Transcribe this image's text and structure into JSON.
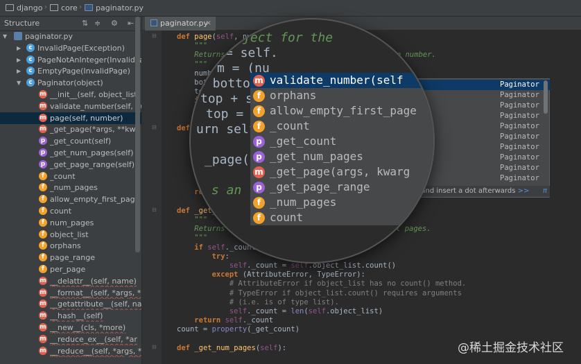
{
  "breadcrumbs": [
    {
      "label": "django",
      "icon": "folder-icon"
    },
    {
      "label": "core",
      "icon": "folder-icon"
    },
    {
      "label": "paginator.py",
      "icon": "python-file-icon"
    }
  ],
  "structure": {
    "title": "Structure",
    "items": [
      {
        "badge": "",
        "label": "paginator.py",
        "expanded": true
      },
      {
        "badge": "c",
        "label": "InvalidPage(Exception)"
      },
      {
        "badge": "c",
        "label": "PageNotAnInteger(InvalidPa"
      },
      {
        "badge": "c",
        "label": "EmptyPage(InvalidPage)"
      },
      {
        "badge": "c",
        "label": "Paginator(object)",
        "expanded": true
      },
      {
        "badge": "m",
        "label": "__init__(self, object_list,"
      },
      {
        "badge": "m",
        "label": "validate_number(self, nu"
      },
      {
        "badge": "m",
        "label": "page(self, number)",
        "selected": true
      },
      {
        "badge": "m",
        "label": "_get_page(*args, **kwa"
      },
      {
        "badge": "p",
        "label": "_get_count(self)"
      },
      {
        "badge": "p",
        "label": "_get_num_pages(self)"
      },
      {
        "badge": "p",
        "label": "_get_page_range(self)"
      },
      {
        "badge": "f",
        "label": "_count"
      },
      {
        "badge": "f",
        "label": "_num_pages"
      },
      {
        "badge": "f",
        "label": "allow_empty_first_page"
      },
      {
        "badge": "f",
        "label": "count"
      },
      {
        "badge": "f",
        "label": "num_pages"
      },
      {
        "badge": "f",
        "label": "object_list"
      },
      {
        "badge": "f",
        "label": "orphans"
      },
      {
        "badge": "f",
        "label": "page_range"
      },
      {
        "badge": "f",
        "label": "per_page"
      },
      {
        "badge": "m",
        "label": "__delattr__(self, name)",
        "dunder": true
      },
      {
        "badge": "m",
        "label": "__format__(self, *args, *",
        "dunder": true
      },
      {
        "badge": "m",
        "label": "__getattribute__(self, na",
        "dunder": true
      },
      {
        "badge": "m",
        "label": "__hash__(self)",
        "dunder": true
      },
      {
        "badge": "m",
        "label": "__new__(cls, *more)",
        "dunder": true
      },
      {
        "badge": "m",
        "label": "__reduce_ex__(self, *ar",
        "dunder": true
      },
      {
        "badge": "m",
        "label": "__reduce__(self, *args, *",
        "dunder": true
      }
    ]
  },
  "editor_tab": {
    "label": "paginator.py",
    "close": "×"
  },
  "code_lines": [
    "def page(self, num",
    "    \"\"\"",
    "    Returns",
    "    \"\"\"",
    "    number",
    "    bott",
    "    top",
    "    if",
    "    r",
    "    ",
    "def _g",
    "    \"\"\"",
    "    Re",
    "    ",
    "    This",
    "    stand",
    "    ",
    "    return F",
    "        ",
    "def _get_count(self",
    "    \"\"\"",
    "    Returns the total number of objects, across all pages.",
    "    \"\"\"",
    "    if self._count is None:",
    "        try:",
    "            self._count = self.object_list.count()",
    "        except (AttributeError, TypeError):",
    "            # AttributeError if object_list has no count() method.",
    "            # TypeError if object_list.count() requires arguments",
    "            # (i.e. is of type list).",
    "            self._count = len(self.object_list)",
    "    return self._count",
    "count = property(_get_count)",
    "",
    "def _get_num_pages(self):"
  ],
  "code_fragments": {
    "doc_partial": "page number.",
    "count_partial": "Ca"
  },
  "lens": {
    "lines": [
      "age object for the",
      "= self.",
      "m = (nu",
      "= bottom",
      "top + se",
      "top = se",
      "urn self.",
      "",
      "_page(*a",
      "",
      "s an ",
      ""
    ],
    "completions": [
      {
        "badge": "m",
        "label": "validate_number(self",
        "selected": true
      },
      {
        "badge": "f",
        "label": "orphans"
      },
      {
        "badge": "f",
        "label": "allow_empty_first_page"
      },
      {
        "badge": "f",
        "label": "_count"
      },
      {
        "badge": "p",
        "label": "_get_count"
      },
      {
        "badge": "p",
        "label": "_get_num_pages"
      },
      {
        "badge": "m",
        "label": "_get_page(args, kwarg"
      },
      {
        "badge": "p",
        "label": "_get_page_range"
      },
      {
        "badge": "f",
        "label": "_num_pages"
      },
      {
        "badge": "f",
        "label": "count"
      }
    ]
  },
  "popup": {
    "rows": [
      "Paginator",
      "Paginator",
      "Paginator",
      "Paginator",
      "Paginator",
      "Paginator",
      "Paginator",
      "Paginator",
      "Paginator",
      "Paginator"
    ],
    "footer_text": "ggestion and insert a dot afterwards",
    "footer_link": ">>",
    "footer_icon": "π"
  },
  "watermark": "@稀土掘金技术社区",
  "colors": {
    "background": "#2b2b2b",
    "panel": "#3c3f41",
    "selection": "#0d3a66",
    "badge_method": "#e0614f",
    "badge_field": "#f0a22d",
    "badge_property": "#9c63d9",
    "badge_class": "#4a9fdf"
  }
}
